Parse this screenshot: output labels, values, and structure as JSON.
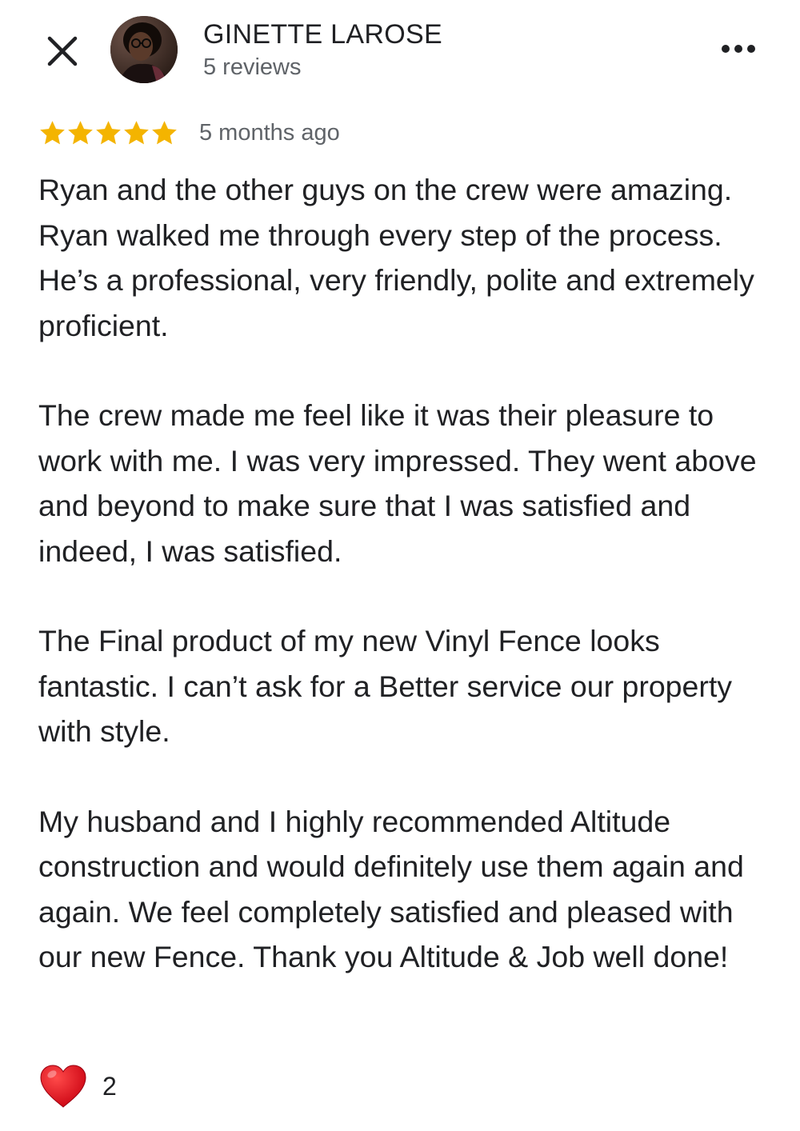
{
  "header": {
    "close_icon": "close-icon",
    "more_icon": "more-horizontal-icon",
    "avatar_icon": "avatar"
  },
  "reviewer": {
    "name": "GINETTE LAROSE",
    "review_count": "5 reviews"
  },
  "rating": {
    "stars": 5,
    "max_stars": 5,
    "star_color": "#f4b400",
    "date": "5 months ago"
  },
  "review": {
    "paragraphs": [
      "Ryan and the other guys on the crew were amazing. Ryan walked me through every step of the process. He’s a professional, very friendly, polite and extremely proficient.",
      "The crew made me feel like it was their pleasure to work with me. I was very impressed. They went above and beyond to make sure that I was satisfied and indeed, I was satisfied.",
      "The Final product of my new Vinyl Fence looks fantastic. I can’t ask for a Better service our property with style.",
      "My husband and I highly recommended Altitude construction and would definitely use them again and again. We feel completely satisfied and pleased with our new Fence. Thank you Altitude & Job well done!"
    ]
  },
  "reaction": {
    "icon": "heart-icon",
    "color": "#e0121f",
    "count": "2"
  }
}
